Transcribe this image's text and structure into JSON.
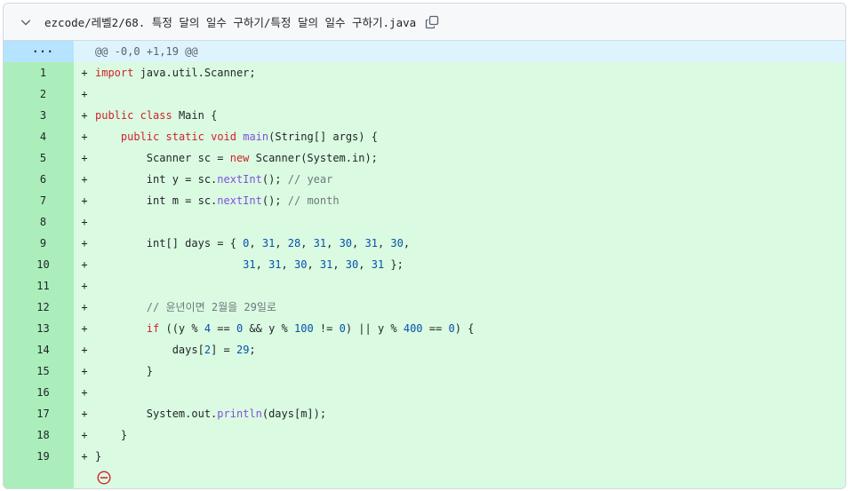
{
  "file": {
    "path": "ezcode/레벨2/68. 특정 달의 일수 구하기/특정 달의 일수 구하기.java",
    "hunk_expander": "···",
    "hunk_header": "@@ -0,0 +1,19 @@",
    "add_marker": "+"
  },
  "lines": [
    {
      "n": "1",
      "code": "import java.util.Scanner;"
    },
    {
      "n": "2",
      "code": ""
    },
    {
      "n": "3",
      "code": "public class Main {"
    },
    {
      "n": "4",
      "code": "    public static void main(String[] args) {"
    },
    {
      "n": "5",
      "code": "        Scanner sc = new Scanner(System.in);"
    },
    {
      "n": "6",
      "code": "        int y = sc.nextInt(); // year"
    },
    {
      "n": "7",
      "code": "        int m = sc.nextInt(); // month"
    },
    {
      "n": "8",
      "code": ""
    },
    {
      "n": "9",
      "code": "        int[] days = { 0, 31, 28, 31, 30, 31, 30,"
    },
    {
      "n": "10",
      "code": "                       31, 31, 30, 31, 30, 31 };"
    },
    {
      "n": "11",
      "code": ""
    },
    {
      "n": "12",
      "code": "        // 윤년이면 2월을 29일로"
    },
    {
      "n": "13",
      "code": "        if ((y % 4 == 0 && y % 100 != 0) || y % 400 == 0) {"
    },
    {
      "n": "14",
      "code": "            days[2] = 29;"
    },
    {
      "n": "15",
      "code": "        }"
    },
    {
      "n": "16",
      "code": ""
    },
    {
      "n": "17",
      "code": "        System.out.println(days[m]);"
    },
    {
      "n": "18",
      "code": "    }"
    },
    {
      "n": "19",
      "code": "}"
    }
  ],
  "colors": {
    "added_bg": "#dafbe1",
    "added_gutter": "#aceebb",
    "hunk_bg": "#ddf4ff",
    "keyword": "#cf222e",
    "function": "#8250df",
    "number": "#0550ae",
    "comment": "#6e7781",
    "no_newline_icon": "#cf222e"
  },
  "icons": {
    "collapse": "chevron-down-icon",
    "copy": "copy-icon",
    "no_newline": "no-entry-icon"
  }
}
